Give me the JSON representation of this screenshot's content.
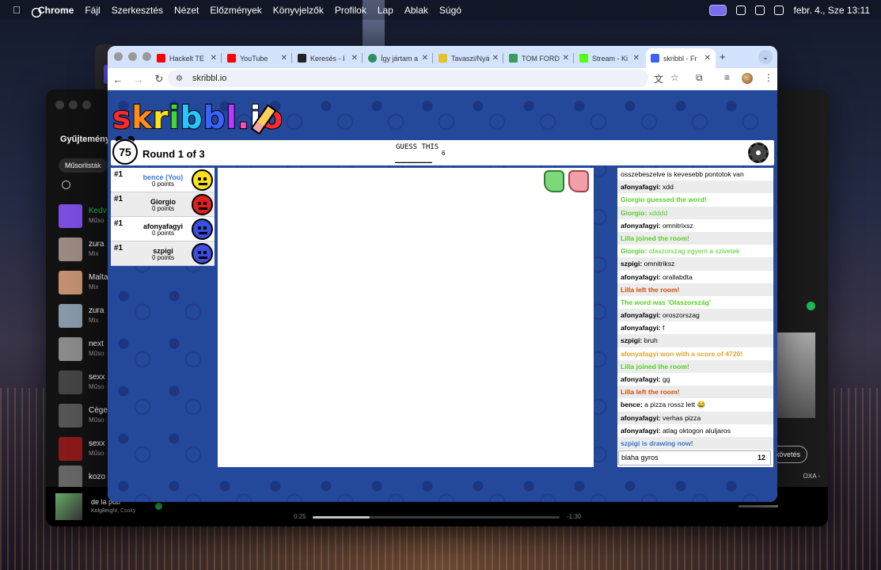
{
  "menubar": {
    "app": "Chrome",
    "items": [
      "Fájl",
      "Szerkesztés",
      "Nézet",
      "Előzmények",
      "Könyvjelzők",
      "Profilok",
      "Lap",
      "Ablak",
      "Súgó"
    ],
    "datetime": "febr. 4., Sze  13:11"
  },
  "spotify": {
    "library_title": "Gyűjtemény",
    "playlists_pill": "Műsorlisták",
    "rows": [
      {
        "title": "Kedv",
        "sub": "Műso"
      },
      {
        "title": "zura",
        "sub": "Mix"
      },
      {
        "title": "Malta",
        "sub": "Mix"
      },
      {
        "title": "zura",
        "sub": "Mix"
      },
      {
        "title": "next",
        "sub": "Műso"
      },
      {
        "title": "sexx",
        "sub": "Műso"
      },
      {
        "title": "Cége",
        "sub": "Műso"
      },
      {
        "title": "sexx",
        "sub": "Műso"
      },
      {
        "title": "kozo",
        "sub": ""
      }
    ],
    "now_playing": {
      "title": "de la pub",
      "artist": "Kolg8eight, Csoky",
      "elapsed": "0:25",
      "remaining": "-1:30",
      "progress": 0.23
    },
    "follow_label": "követés",
    "side_text": "OXA -"
  },
  "chrome": {
    "tabs": [
      {
        "label": "Hackelt TE",
        "favicon_color": "#ff0000"
      },
      {
        "label": "YouTube",
        "favicon_color": "#ff0000"
      },
      {
        "label": "Keresés - I",
        "favicon_color": "#222222"
      },
      {
        "label": "Így jártam a",
        "favicon_color": "#2f8f5a"
      },
      {
        "label": "Tavaszi/Nyá",
        "favicon_color": "#e3c22a"
      },
      {
        "label": "TOM FORD",
        "favicon_color": "#3a9b5a"
      },
      {
        "label": "Stream - Ki",
        "favicon_color": "#53fc18"
      },
      {
        "label": "skribbl - Fr",
        "favicon_color": "#3a62ff",
        "active": true
      }
    ],
    "url": "skribbl.io"
  },
  "game": {
    "logo": "skribbl.io",
    "timer": "75",
    "round": "Round 1 of 3",
    "hint_label": "GUESS THIS",
    "word_pattern": "______",
    "word_length": "6",
    "players": [
      {
        "rank": "#1",
        "name": "bence (You)",
        "points": "0 points",
        "color": "#ffe21a",
        "you": true
      },
      {
        "rank": "#1",
        "name": "Giorgio",
        "points": "0 points",
        "color": "#e02020"
      },
      {
        "rank": "#1",
        "name": "afonyafagyi",
        "points": "0 points",
        "color": "#3a4fe0"
      },
      {
        "rank": "#1",
        "name": "szpigi",
        "points": "0 points",
        "color": "#3a4fe0"
      }
    ],
    "chat": [
      {
        "user": "",
        "text": "osszebeszelve is kevesebb pontotok van",
        "type": "normal"
      },
      {
        "user": "afonyafagyi:",
        "text": " xdd",
        "type": "normal"
      },
      {
        "user": "",
        "text": "Giorgio guessed the word!",
        "type": "guessed"
      },
      {
        "user": "Giorgio:",
        "text": " xdddd",
        "type": "green"
      },
      {
        "user": "afonyafagyi:",
        "text": " omnitrixsz",
        "type": "normal"
      },
      {
        "user": "",
        "text": "Lilla joined the room!",
        "type": "guessed"
      },
      {
        "user": "Giorgio:",
        "text": " olaszorszag egyem a szivetek",
        "type": "green"
      },
      {
        "user": "szpigi:",
        "text": " omnitriksz",
        "type": "normal"
      },
      {
        "user": "afonyafagyi:",
        "text": " orallabdta",
        "type": "normal"
      },
      {
        "user": "",
        "text": "Lilla left the room!",
        "type": "red"
      },
      {
        "user": "",
        "text": "The word was 'Olaszország'",
        "type": "guessed"
      },
      {
        "user": "afonyafagyi:",
        "text": " oroszorszag",
        "type": "normal"
      },
      {
        "user": "afonyafagyi:",
        "text": " f",
        "type": "normal"
      },
      {
        "user": "szpigi:",
        "text": " bruh",
        "type": "normal"
      },
      {
        "user": "",
        "text": "afonyafagyi won with a score of 4720!",
        "type": "orange"
      },
      {
        "user": "",
        "text": "Lilla joined the room!",
        "type": "guessed"
      },
      {
        "user": "afonyafagyi:",
        "text": " gg",
        "type": "normal"
      },
      {
        "user": "",
        "text": "Lilla left the room!",
        "type": "red"
      },
      {
        "user": "bence:",
        "text": " a pizza rossz lett 😂",
        "type": "normal"
      },
      {
        "user": "afonyafagyi:",
        "text": " verhas pizza",
        "type": "normal"
      },
      {
        "user": "afonyafagyi:",
        "text": " atlag oktogon aluljaros",
        "type": "normal"
      },
      {
        "user": "",
        "text": "szpigi is drawing now!",
        "type": "blue"
      }
    ],
    "chat_input": "blaha gyros",
    "chat_remaining": "12"
  }
}
